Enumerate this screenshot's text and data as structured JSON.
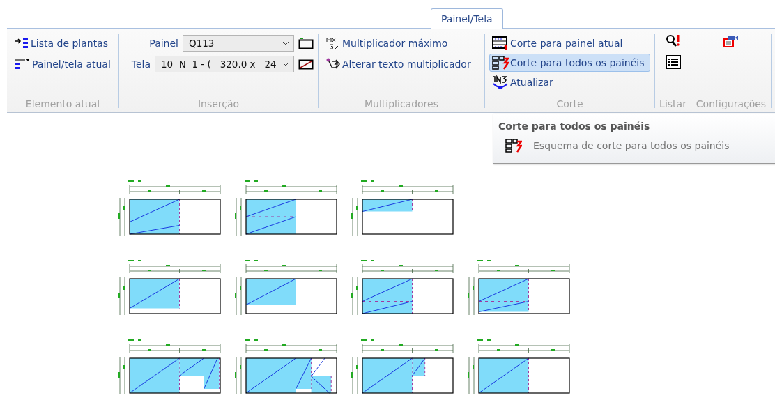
{
  "tab": {
    "label": "Painel/Tela",
    "selected": true
  },
  "elemento_atual": {
    "label": "Elemento atual",
    "items": [
      {
        "label": "Lista de plantas"
      },
      {
        "label": "Painel/tela atual"
      }
    ]
  },
  "insercao": {
    "label": "Inserção",
    "fields": [
      {
        "label": "Painel",
        "value": "Q113"
      },
      {
        "label": "Tela",
        "value": "10  N  1 - (   320.0 x   24"
      }
    ]
  },
  "multiplicadores": {
    "label": "Multiplicadores",
    "items": [
      {
        "label": "Multiplicador máximo"
      },
      {
        "label": "Alterar texto multiplicador"
      }
    ]
  },
  "corte": {
    "label": "Corte",
    "items": [
      {
        "label": "Corte para painel atual",
        "highlighted": false
      },
      {
        "label": "Corte para todos os painéis",
        "highlighted": true
      },
      {
        "label": "Atualizar",
        "highlighted": false
      }
    ]
  },
  "listar": {
    "label": "Listar"
  },
  "configuracoes": {
    "label": "Configurações"
  },
  "tooltip": {
    "title": "Corte para todos os painéis",
    "description": "Esquema de corte para todos os painéis"
  }
}
